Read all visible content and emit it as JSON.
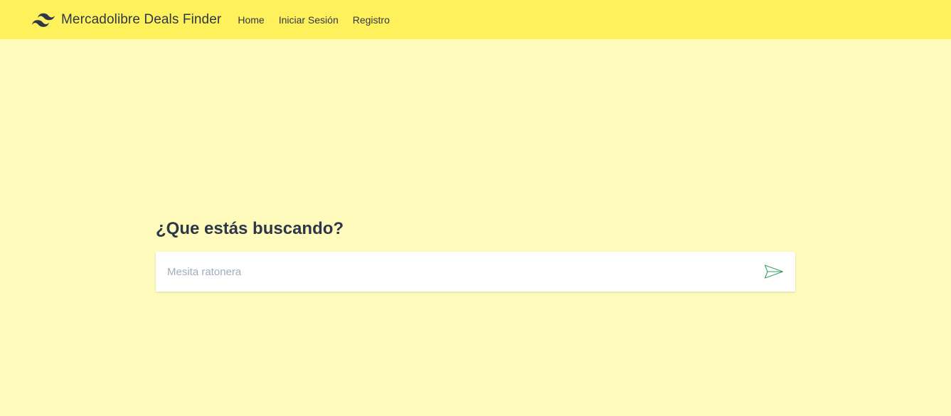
{
  "header": {
    "brand_name": "Mercadolibre Deals Finder",
    "logo_icon": "wave-logo-icon",
    "nav": [
      {
        "label": "Home"
      },
      {
        "label": "Iniciar Sesión"
      },
      {
        "label": "Registro"
      }
    ]
  },
  "search": {
    "heading": "¿Que estás buscando?",
    "placeholder": "Mesita ratonera",
    "value": "",
    "submit_icon": "paper-plane-send-icon"
  },
  "colors": {
    "navbar_bg": "#fff15c",
    "page_bg": "#fefbbd",
    "text_dark": "#2d3748",
    "placeholder": "#a0aec0",
    "send_icon": "#38a169"
  }
}
